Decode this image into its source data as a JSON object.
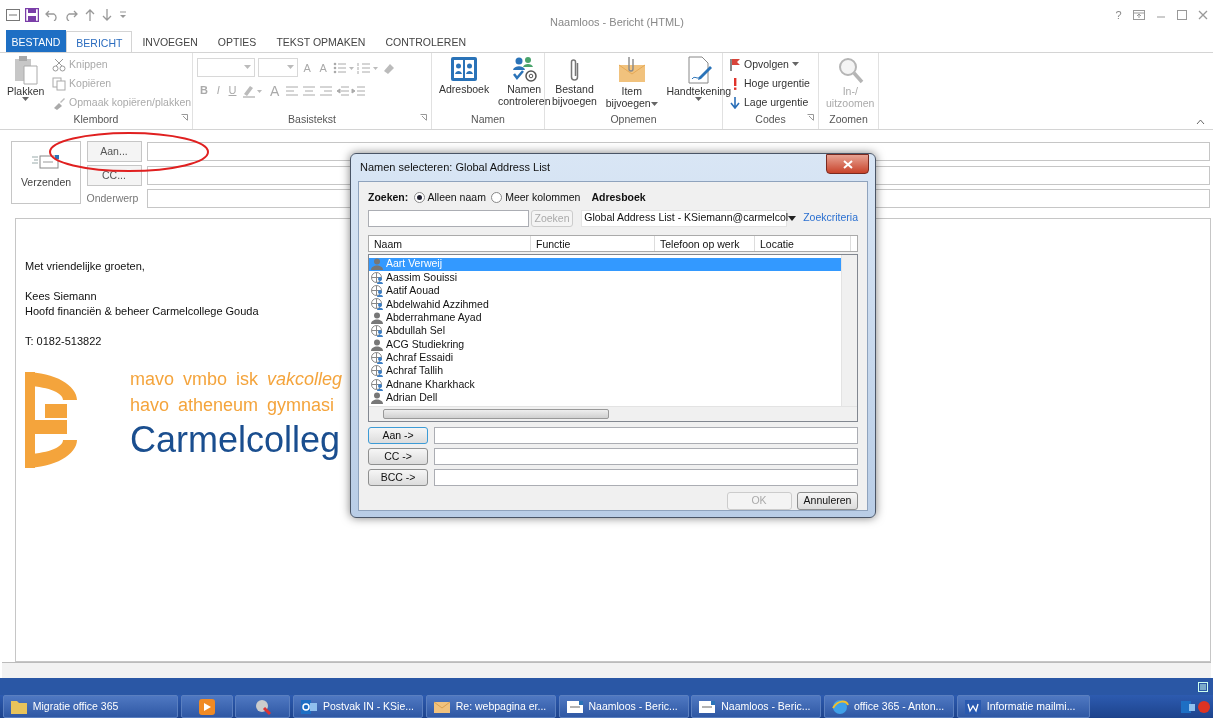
{
  "window": {
    "title": "Naamloos - Bericht (HTML)",
    "help": "?"
  },
  "ribbon_tabs": [
    {
      "label": "BESTAND",
      "kind": "file",
      "selected": false
    },
    {
      "label": "BERICHT",
      "kind": "tab",
      "selected": true
    },
    {
      "label": "INVOEGEN",
      "kind": "tab",
      "selected": false
    },
    {
      "label": "OPTIES",
      "kind": "tab",
      "selected": false
    },
    {
      "label": "TEKST OPMAKEN",
      "kind": "tab",
      "selected": false
    },
    {
      "label": "CONTROLEREN",
      "kind": "tab",
      "selected": false
    }
  ],
  "ribbon_groups": [
    {
      "label": "Klembord",
      "kind": "clipboard",
      "launcher": true,
      "commands": [
        {
          "kind": "large",
          "lines": [
            "Plakken"
          ],
          "dropdown": true,
          "disabled": false
        },
        {
          "kind": "small",
          "lines": [
            "Knippen"
          ],
          "disabled": true
        },
        {
          "kind": "small",
          "lines": [
            "Kopiëren"
          ],
          "disabled": true
        },
        {
          "kind": "small",
          "lines": [
            "Opmaak kopiëren/plakken"
          ],
          "disabled": true
        }
      ]
    },
    {
      "label": "Basistekst",
      "kind": "font",
      "launcher": true,
      "disabled": true,
      "size_buttons": [
        "A",
        "A"
      ],
      "style_buttons": [
        "B",
        "I",
        "U"
      ],
      "color_button": "A"
    },
    {
      "label": "Namen",
      "kind": "names",
      "launcher": false,
      "commands": [
        {
          "kind": "large",
          "lines": [
            "Adresboek"
          ],
          "disabled": false
        },
        {
          "kind": "large",
          "lines": [
            "Namen",
            "controleren"
          ],
          "disabled": false
        }
      ]
    },
    {
      "label": "Opnemen",
      "kind": "include",
      "launcher": false,
      "commands": [
        {
          "kind": "large",
          "lines": [
            "Bestand",
            "bijvoegen"
          ],
          "disabled": false
        },
        {
          "kind": "large",
          "lines": [
            "Item",
            "bijvoegen"
          ],
          "dropdown": true,
          "disabled": false
        },
        {
          "kind": "large",
          "lines": [
            "Handtekening"
          ],
          "dropdown": true,
          "disabled": false
        }
      ]
    },
    {
      "label": "Codes",
      "kind": "tags",
      "launcher": true,
      "commands": [
        {
          "kind": "small",
          "lines": [
            "Opvolgen"
          ],
          "dropdown": true,
          "disabled": false
        },
        {
          "kind": "small",
          "lines": [
            "Hoge urgentie"
          ],
          "disabled": false
        },
        {
          "kind": "small",
          "lines": [
            "Lage urgentie"
          ],
          "disabled": false
        }
      ]
    },
    {
      "label": "Zoomen",
      "kind": "zoom",
      "launcher": false,
      "commands": [
        {
          "kind": "large",
          "lines": [
            "In-/",
            "uitzoomen"
          ],
          "disabled": true
        }
      ]
    }
  ],
  "compose": {
    "send": "Verzenden",
    "to": "Aan...",
    "cc": "CC...",
    "subject_label": "Onderwerp"
  },
  "body": {
    "paragraphs": [
      [
        "Met vriendelijke groeten,"
      ],
      [
        "Kees Siemann",
        "Hoofd financiën & beheer Carmelcollege Gouda"
      ],
      [
        "T: 0182-513822"
      ]
    ],
    "logo": {
      "lines": [
        "mavo vmbo isk *vakcolleg*",
        "havo atheneum gymnasi"
      ],
      "name": "Carmelcolleg"
    }
  },
  "dialog": {
    "title": "Namen selecteren: Global Address List",
    "search_label": "Zoeken:",
    "search_options": [
      {
        "label": "Alleen naam",
        "selected": true
      },
      {
        "label": "Meer kolommen",
        "selected": false
      }
    ],
    "address_book_label": "Adresboek",
    "search_button": "Zoeken",
    "address_book": "Global Address List - KSiemann@carmelcol",
    "criteria_link": "Zoekcriteria",
    "columns": [
      "Naam",
      "Functie",
      "Telefoon op werk",
      "Locatie"
    ],
    "rows": [
      {
        "name": "Aart Verweij",
        "kind": "user",
        "selected": true
      },
      {
        "name": "Aassim Souissi",
        "kind": "external",
        "selected": false
      },
      {
        "name": "Aatif Aouad",
        "kind": "external",
        "selected": false
      },
      {
        "name": "Abdelwahid Azzihmed",
        "kind": "external",
        "selected": false
      },
      {
        "name": "Abderrahmane Ayad",
        "kind": "user",
        "selected": false
      },
      {
        "name": "Abdullah Sel",
        "kind": "external",
        "selected": false
      },
      {
        "name": "ACG Studiekring",
        "kind": "user",
        "selected": false
      },
      {
        "name": "Achraf Essaidi",
        "kind": "external",
        "selected": false
      },
      {
        "name": "Achraf Tallih",
        "kind": "external",
        "selected": false
      },
      {
        "name": "Adnane Kharkhack",
        "kind": "external",
        "selected": false
      },
      {
        "name": "Adrian Dell",
        "kind": "user",
        "selected": false
      }
    ],
    "recipient_buttons": [
      "Aan ->",
      "CC ->",
      "BCC ->"
    ],
    "ok": {
      "label": "OK",
      "disabled": true
    },
    "cancel": "Annuleren"
  },
  "taskbar": [
    {
      "kind": "folder",
      "label": "Migratie office 365"
    },
    {
      "kind": "media"
    },
    {
      "kind": "tool"
    },
    {
      "kind": "mail",
      "label": "Postvak IN - KSie..."
    },
    {
      "kind": "envelope",
      "label": "Re: webpagina er..."
    },
    {
      "kind": "message",
      "label": "Naamloos - Beric..."
    },
    {
      "kind": "message",
      "label": "Naamloos - Beric..."
    },
    {
      "kind": "browser",
      "label": "office 365 - Anton..."
    },
    {
      "kind": "word",
      "label": "Informatie mailmi..."
    }
  ]
}
